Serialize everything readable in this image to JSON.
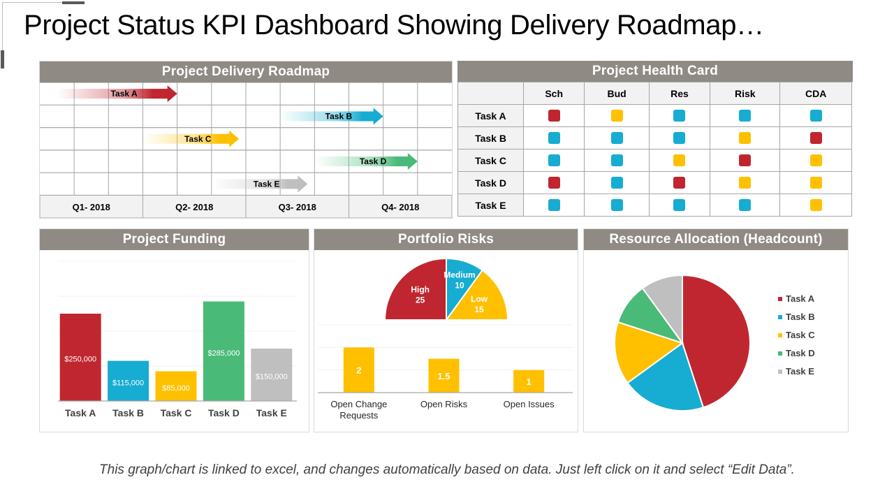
{
  "title": "Project Status KPI Dashboard Showing Delivery Roadmap…",
  "colors": {
    "header_bg": "#8f8a84",
    "red": "#c0262f",
    "blue": "#17acd1",
    "yellow": "#ffc000",
    "green": "#4aba78",
    "gray": "#bfbfbf"
  },
  "roadmap": {
    "title": "Project Delivery Roadmap",
    "quarters": [
      "Q1- 2018",
      "Q2- 2018",
      "Q3- 2018",
      "Q4- 2018"
    ],
    "tasks": [
      {
        "label": "Task A",
        "start_month": 0.5,
        "end_month": 4,
        "color": "#c0262f"
      },
      {
        "label": "Task B",
        "start_month": 7,
        "end_month": 10,
        "color": "#17acd1"
      },
      {
        "label": "Task C",
        "start_month": 3,
        "end_month": 5.8,
        "color": "#ffc000"
      },
      {
        "label": "Task D",
        "start_month": 8,
        "end_month": 11,
        "color": "#4aba78"
      },
      {
        "label": "Task E",
        "start_month": 5,
        "end_month": 7.8,
        "color": "#bfbfbf"
      }
    ]
  },
  "health": {
    "title": "Project Health Card",
    "columns": [
      "Sch",
      "Bud",
      "Res",
      "Risk",
      "CDA"
    ],
    "rows": [
      {
        "label": "Task A",
        "status": [
          "red",
          "yellow",
          "blue",
          "blue",
          "blue"
        ]
      },
      {
        "label": "Task B",
        "status": [
          "blue",
          "blue",
          "blue",
          "yellow",
          "red"
        ]
      },
      {
        "label": "Task C",
        "status": [
          "blue",
          "blue",
          "yellow",
          "red",
          "yellow"
        ]
      },
      {
        "label": "Task D",
        "status": [
          "red",
          "blue",
          "red",
          "yellow",
          "yellow"
        ]
      },
      {
        "label": "Task E",
        "status": [
          "blue",
          "blue",
          "blue",
          "blue",
          "yellow"
        ]
      }
    ]
  },
  "funding": {
    "title": "Project Funding"
  },
  "risks": {
    "title": "Portfolio Risks"
  },
  "resources": {
    "title": "Resource Allocation  (Headcount)"
  },
  "footer_note": "This graph/chart is linked to excel, and changes automatically based on data. Just left click on it and select “Edit Data”.",
  "chart_data": [
    {
      "type": "bar",
      "title": "Project Funding",
      "categories": [
        "Task A",
        "Task B",
        "Task C",
        "Task D",
        "Task E"
      ],
      "values": [
        250000,
        115000,
        85000,
        285000,
        150000
      ],
      "labels": [
        "$250,000",
        "$115,000",
        "$85,000",
        "$285,000",
        "$150,000"
      ],
      "colors": [
        "#c0262f",
        "#17acd1",
        "#ffc000",
        "#4aba78",
        "#bfbfbf"
      ],
      "ylim": [
        0,
        400000
      ],
      "grid": true,
      "xlabel": "",
      "ylabel": ""
    },
    {
      "type": "pie",
      "subtype": "half-donut",
      "title": "Portfolio Risks",
      "categories": [
        "High",
        "Medium",
        "Low"
      ],
      "values": [
        25,
        10,
        15
      ],
      "colors": [
        "#c0262f",
        "#17acd1",
        "#ffc000"
      ]
    },
    {
      "type": "bar",
      "title": "Portfolio Risks",
      "categories": [
        "Open Change Requests",
        "Open Risks",
        "Open Issues"
      ],
      "category_lines": [
        [
          "Open Change",
          "Requests"
        ],
        [
          "Open Risks"
        ],
        [
          "Open Issues"
        ]
      ],
      "values": [
        2,
        1.5,
        1
      ],
      "labels": [
        "2",
        "1.5",
        "1"
      ],
      "color": "#ffc000",
      "ylim": [
        0,
        3
      ],
      "grid": true
    },
    {
      "type": "pie",
      "title": "Resource Allocation (Headcount)",
      "categories": [
        "Task A",
        "Task B",
        "Task C",
        "Task D",
        "Task E"
      ],
      "values": [
        45,
        20,
        15,
        10,
        10
      ],
      "colors": [
        "#c0262f",
        "#17acd1",
        "#ffc000",
        "#4aba78",
        "#bfbfbf"
      ],
      "legend": "right"
    }
  ]
}
